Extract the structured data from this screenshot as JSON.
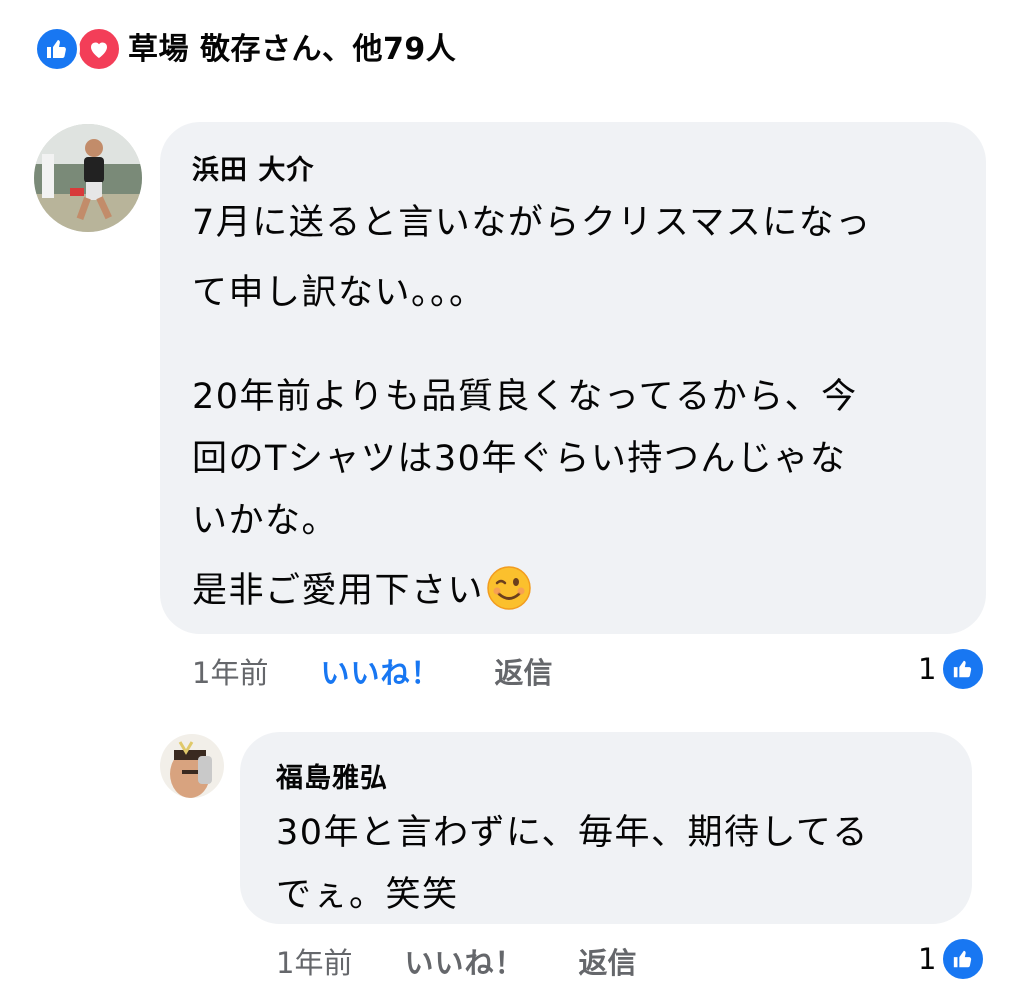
{
  "reactions": {
    "summary": "草場 敬存さん、他79人",
    "icons": [
      "like-icon",
      "love-icon"
    ],
    "colors": {
      "like": "#1877f2",
      "love": "#f33e58"
    }
  },
  "comments": [
    {
      "author": "浜田 大介",
      "lines": [
        "7月に送ると言いながらクリスマスになっ",
        "て申し訳ない。。。",
        "20年前よりも品質良くなってるから、今",
        "回のTシャツは30年ぐらい持つんじゃな",
        "いかな。",
        "是非ご愛用下さい"
      ],
      "emoji": "winking-face-icon",
      "time": "1年前",
      "like_label": "いいね！",
      "reply_label": "返信",
      "like_count": "1",
      "liked": true
    },
    {
      "author": "福島雅弘",
      "lines": [
        "30年と言わずに、毎年、期待してる",
        "でぇ。笑笑"
      ],
      "time": "1年前",
      "like_label": "いいね！",
      "reply_label": "返信",
      "like_count": "1",
      "liked": false
    }
  ]
}
